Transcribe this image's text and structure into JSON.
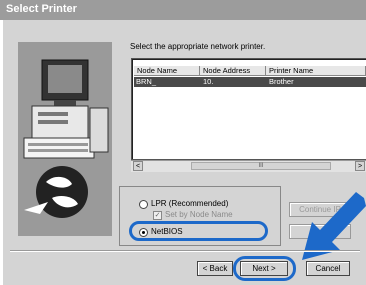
{
  "window": {
    "title": "Select Printer"
  },
  "instruction": "Select the appropriate network printer.",
  "printer_list": {
    "columns": [
      "Node Name",
      "Node Address",
      "Printer Name"
    ],
    "rows": [
      {
        "node_name": "BRN_",
        "node_address": "10.",
        "printer_name": "Brother"
      }
    ]
  },
  "scrollbar": {
    "left_arrow": "<",
    "right_arrow": ">",
    "thumb": "III"
  },
  "options": {
    "lpr_label": "LPR (Recommended)",
    "set_by_node_name_label": "Set by Node Name",
    "netbios_label": "NetBIOS",
    "selected": "NetBIOS"
  },
  "buttons": {
    "continue_ip": "Continue IP",
    "back": "< Back",
    "next": "Next >",
    "cancel": "Cancel"
  },
  "highlight_color": "#1d69c9"
}
